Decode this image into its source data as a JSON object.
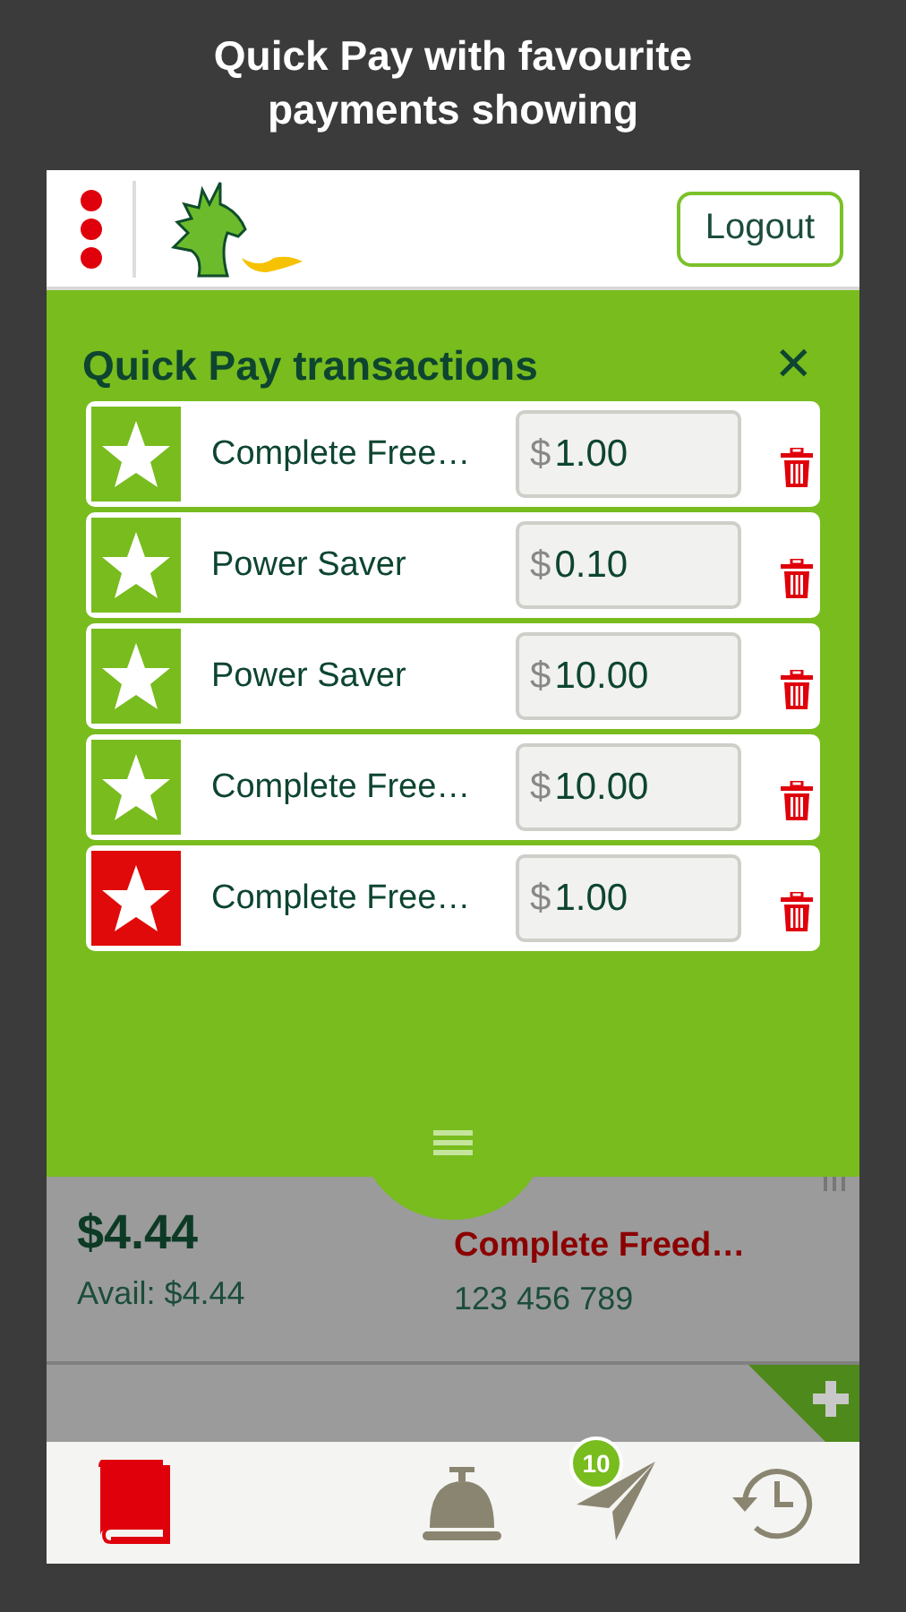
{
  "caption": [
    "Quick Pay with favourite",
    "payments showing"
  ],
  "header": {
    "logout": "Logout"
  },
  "panel": {
    "title": "Quick Pay transactions",
    "close": "✕",
    "rows": [
      {
        "name": "Complete Free…",
        "currency": "$",
        "amount": "1.00",
        "color": "#78bc1e"
      },
      {
        "name": "Power Saver",
        "currency": "$",
        "amount": "0.10",
        "color": "#78bc1e"
      },
      {
        "name": "Power Saver",
        "currency": "$",
        "amount": "10.00",
        "color": "#78bc1e"
      },
      {
        "name": "Complete Free…",
        "currency": "$",
        "amount": "10.00",
        "color": "#78bc1e"
      },
      {
        "name": "Complete Free…",
        "currency": "$",
        "amount": "1.00",
        "color": "#e10a0a"
      }
    ]
  },
  "account": {
    "balance": "$4.44",
    "available": "Avail: $4.44",
    "name": "Complete Freed…",
    "number": "123 456 789"
  },
  "nav": {
    "badge": "10"
  }
}
